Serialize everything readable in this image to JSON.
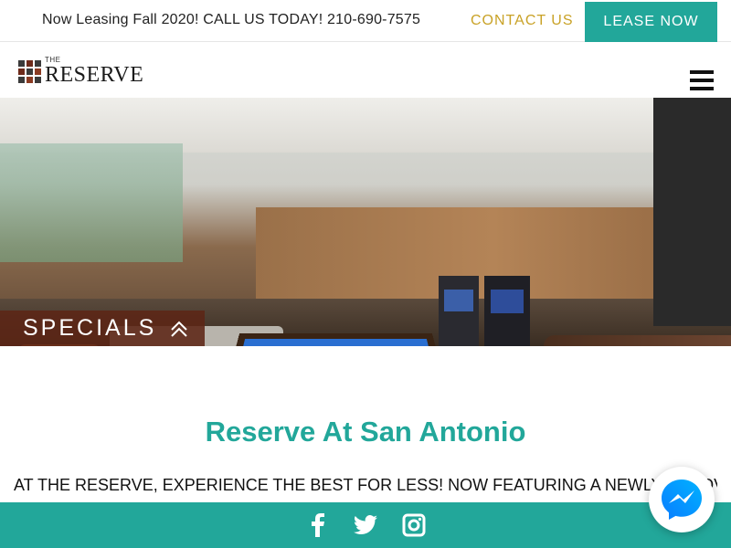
{
  "topbar": {
    "promo_text": "Now Leasing Fall 2020! CALL US TODAY! 210-690-7575",
    "contact_label": "CONTACT US",
    "lease_label": "LEASE NOW"
  },
  "logo": {
    "the": "THE",
    "name": "RESERVE"
  },
  "hero": {
    "specials_label": "SPECIALS"
  },
  "main": {
    "title": "Reserve At San Antonio",
    "tagline": "AT THE RESERVE, EXPERIENCE THE BEST FOR LESS! NOW FEATURING A NEWLY RENOVATED"
  },
  "footer": {
    "icons": [
      "facebook-icon",
      "twitter-icon",
      "instagram-icon"
    ]
  },
  "colors": {
    "accent": "#22a79a",
    "gold": "#c9a227",
    "specials_bg": "#5c2616"
  }
}
